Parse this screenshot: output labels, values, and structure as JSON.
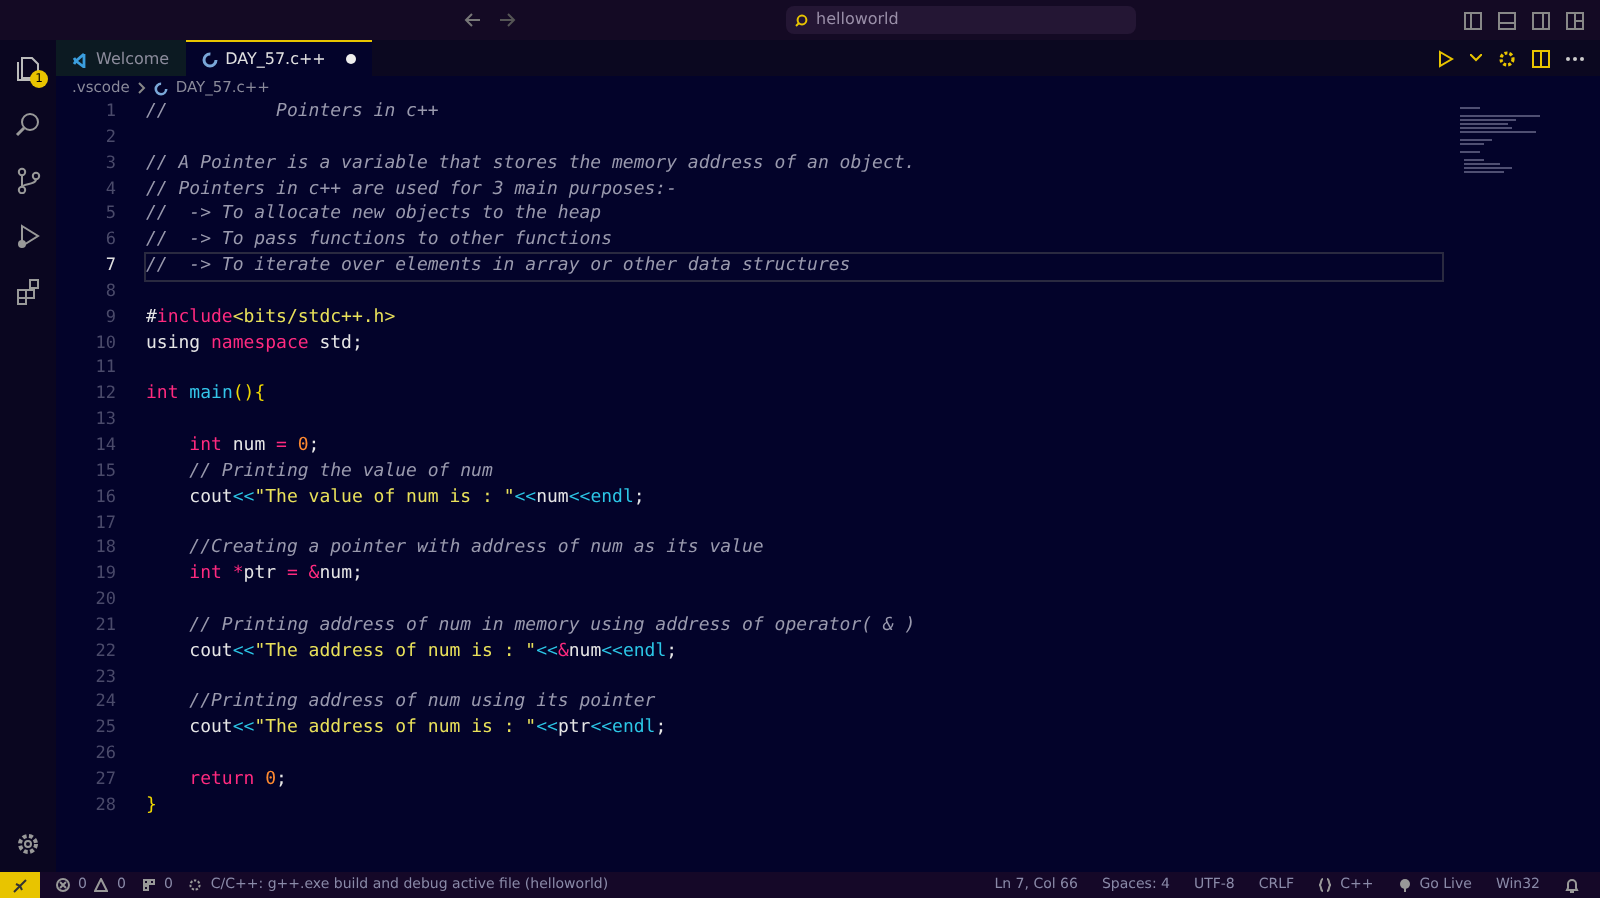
{
  "title_bar": {
    "search": "helloworld"
  },
  "activity_bar": {
    "explorer_badge": "1"
  },
  "tabs": [
    {
      "label": "Welcome",
      "selected": false,
      "kind": "welcome",
      "modified": false
    },
    {
      "label": "DAY_57.c++",
      "selected": true,
      "kind": "cpp",
      "modified": true
    }
  ],
  "breadcrumb": [
    ".vscode",
    "DAY_57.c++"
  ],
  "editor": {
    "lines": [
      {
        "number": "1",
        "current": false,
        "tokens": [
          {
            "kind": "comment",
            "text": "//          Pointers in c++"
          }
        ]
      },
      {
        "number": "2",
        "current": false
      },
      {
        "number": "3",
        "current": false,
        "tokens": [
          {
            "kind": "comment",
            "text": "// A Pointer is a variable that stores the memory address of an object."
          }
        ]
      },
      {
        "number": "4",
        "current": false,
        "tokens": [
          {
            "kind": "comment",
            "text": "// Pointers in c++ are used for 3 main purposes:-"
          }
        ]
      },
      {
        "number": "5",
        "current": false,
        "tokens": [
          {
            "kind": "comment",
            "text": "//  -> To allocate new objects to the heap"
          }
        ]
      },
      {
        "number": "6",
        "current": false,
        "tokens": [
          {
            "kind": "comment",
            "text": "//  -> To pass functions to other functions"
          }
        ]
      },
      {
        "number": "7",
        "current": true,
        "tokens": [
          {
            "kind": "comment",
            "text": "//  -> To iterate over elements in array or other data structures"
          }
        ]
      },
      {
        "number": "8",
        "current": false
      },
      {
        "number": "9",
        "current": false,
        "tokens": [
          {
            "kind": "plain",
            "text": "#"
          },
          {
            "kind": "keyword",
            "text": "include"
          },
          {
            "kind": "string",
            "text": "<bits/stdc++.h>"
          }
        ]
      },
      {
        "number": "10",
        "current": false,
        "tokens": [
          {
            "kind": "plain",
            "text": "using "
          },
          {
            "kind": "keyword",
            "text": "namespace"
          },
          {
            "kind": "plain",
            "text": " std;"
          }
        ]
      },
      {
        "number": "11",
        "current": false
      },
      {
        "number": "12",
        "current": false,
        "tokens": [
          {
            "kind": "keyword",
            "text": "int"
          },
          {
            "kind": "function",
            "text": " main"
          },
          {
            "kind": "brace",
            "text": "(){"
          }
        ]
      },
      {
        "number": "13",
        "current": false
      },
      {
        "number": "14",
        "current": false,
        "tokens": [
          {
            "kind": "keyword",
            "text": "    int"
          },
          {
            "kind": "plain",
            "text": " num "
          },
          {
            "kind": "keyword",
            "text": "= "
          },
          {
            "kind": "number",
            "text": "0"
          },
          {
            "kind": "plain",
            "text": ";"
          }
        ]
      },
      {
        "number": "15",
        "current": false,
        "tokens": [
          {
            "kind": "comment",
            "text": "    // Printing the value of num"
          }
        ]
      },
      {
        "number": "16",
        "current": false,
        "tokens": [
          {
            "kind": "plain",
            "text": "    cout"
          },
          {
            "kind": "operator",
            "text": "<<"
          },
          {
            "kind": "string",
            "text": "\"The value of num is : \""
          },
          {
            "kind": "operator",
            "text": "<<"
          },
          {
            "kind": "plain",
            "text": "num"
          },
          {
            "kind": "operator",
            "text": "<<endl"
          },
          {
            "kind": "plain",
            "text": ";"
          }
        ]
      },
      {
        "number": "17",
        "current": false
      },
      {
        "number": "18",
        "current": false,
        "tokens": [
          {
            "kind": "comment",
            "text": "    //Creating a pointer with address of num as its value"
          }
        ]
      },
      {
        "number": "19",
        "current": false,
        "tokens": [
          {
            "kind": "keyword",
            "text": "    int *"
          },
          {
            "kind": "plain",
            "text": "ptr "
          },
          {
            "kind": "keyword",
            "text": "= &"
          },
          {
            "kind": "plain",
            "text": "num;"
          }
        ]
      },
      {
        "number": "20",
        "current": false
      },
      {
        "number": "21",
        "current": false,
        "tokens": [
          {
            "kind": "comment",
            "text": "    // Printing address of num in memory using address of operator( & )"
          }
        ]
      },
      {
        "number": "22",
        "current": false,
        "tokens": [
          {
            "kind": "plain",
            "text": "    cout"
          },
          {
            "kind": "operator",
            "text": "<<"
          },
          {
            "kind": "string",
            "text": "\"The address of num is : \""
          },
          {
            "kind": "operator",
            "text": "<<"
          },
          {
            "kind": "keyword",
            "text": "&"
          },
          {
            "kind": "plain",
            "text": "num"
          },
          {
            "kind": "operator",
            "text": "<<endl"
          },
          {
            "kind": "plain",
            "text": ";"
          }
        ]
      },
      {
        "number": "23",
        "current": false
      },
      {
        "number": "24",
        "current": false,
        "tokens": [
          {
            "kind": "comment",
            "text": "    //Printing address of num using its pointer"
          }
        ]
      },
      {
        "number": "25",
        "current": false,
        "tokens": [
          {
            "kind": "plain",
            "text": "    cout"
          },
          {
            "kind": "operator",
            "text": "<<"
          },
          {
            "kind": "string",
            "text": "\"The address of num is : \""
          },
          {
            "kind": "operator",
            "text": "<<"
          },
          {
            "kind": "plain",
            "text": "ptr"
          },
          {
            "kind": "operator",
            "text": "<<endl"
          },
          {
            "kind": "plain",
            "text": ";"
          }
        ]
      },
      {
        "number": "26",
        "current": false
      },
      {
        "number": "27",
        "current": false,
        "tokens": [
          {
            "kind": "keyword",
            "text": "    return "
          },
          {
            "kind": "number",
            "text": "0"
          },
          {
            "kind": "plain",
            "text": ";"
          }
        ]
      },
      {
        "number": "28",
        "current": false,
        "tokens": [
          {
            "kind": "brace",
            "text": "}"
          }
        ]
      }
    ]
  },
  "status_bar": {
    "errors": "0",
    "warnings": "0",
    "ports": "0",
    "task": "C/C++: g++.exe build and debug active file (helloworld)",
    "right": [
      "Ln 7, Col 66",
      "Spaces: 4",
      "UTF-8",
      "CRLF",
      "C++",
      "Go Live",
      "Win32"
    ]
  }
}
